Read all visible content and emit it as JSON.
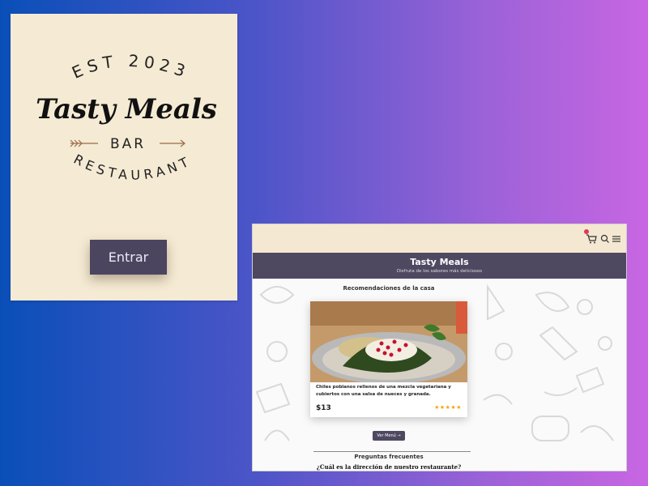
{
  "splash": {
    "logo": {
      "est": "EST 2023",
      "brand": "Tasty Meals",
      "bar": "BAR",
      "restaurant": "RESTAURANT"
    },
    "enter_label": "Entrar"
  },
  "app": {
    "header": {
      "icons": [
        "cart-icon",
        "search-icon",
        "menu-icon"
      ],
      "title": "Tasty Meals",
      "subtitle": "Disfruta de los sabores más deliciosos"
    },
    "recommendations": {
      "title": "Recomendaciones de la casa",
      "dish": {
        "description": "Chiles poblanos rellenos de una mezcla vegetariana y cubiertos con una salsa de nueces y granada.",
        "price": "$13",
        "stars": "★★★★★"
      },
      "menu_button": "Ver Menú"
    },
    "faq": {
      "title": "Preguntas frecuentes",
      "question": "¿Cuál es la dirección de nuestro restaurante?"
    }
  },
  "colors": {
    "cream": "#f5ead3",
    "header_purple": "#4e4861",
    "badge_red": "#e0385a",
    "star_gold": "#f2a512"
  }
}
